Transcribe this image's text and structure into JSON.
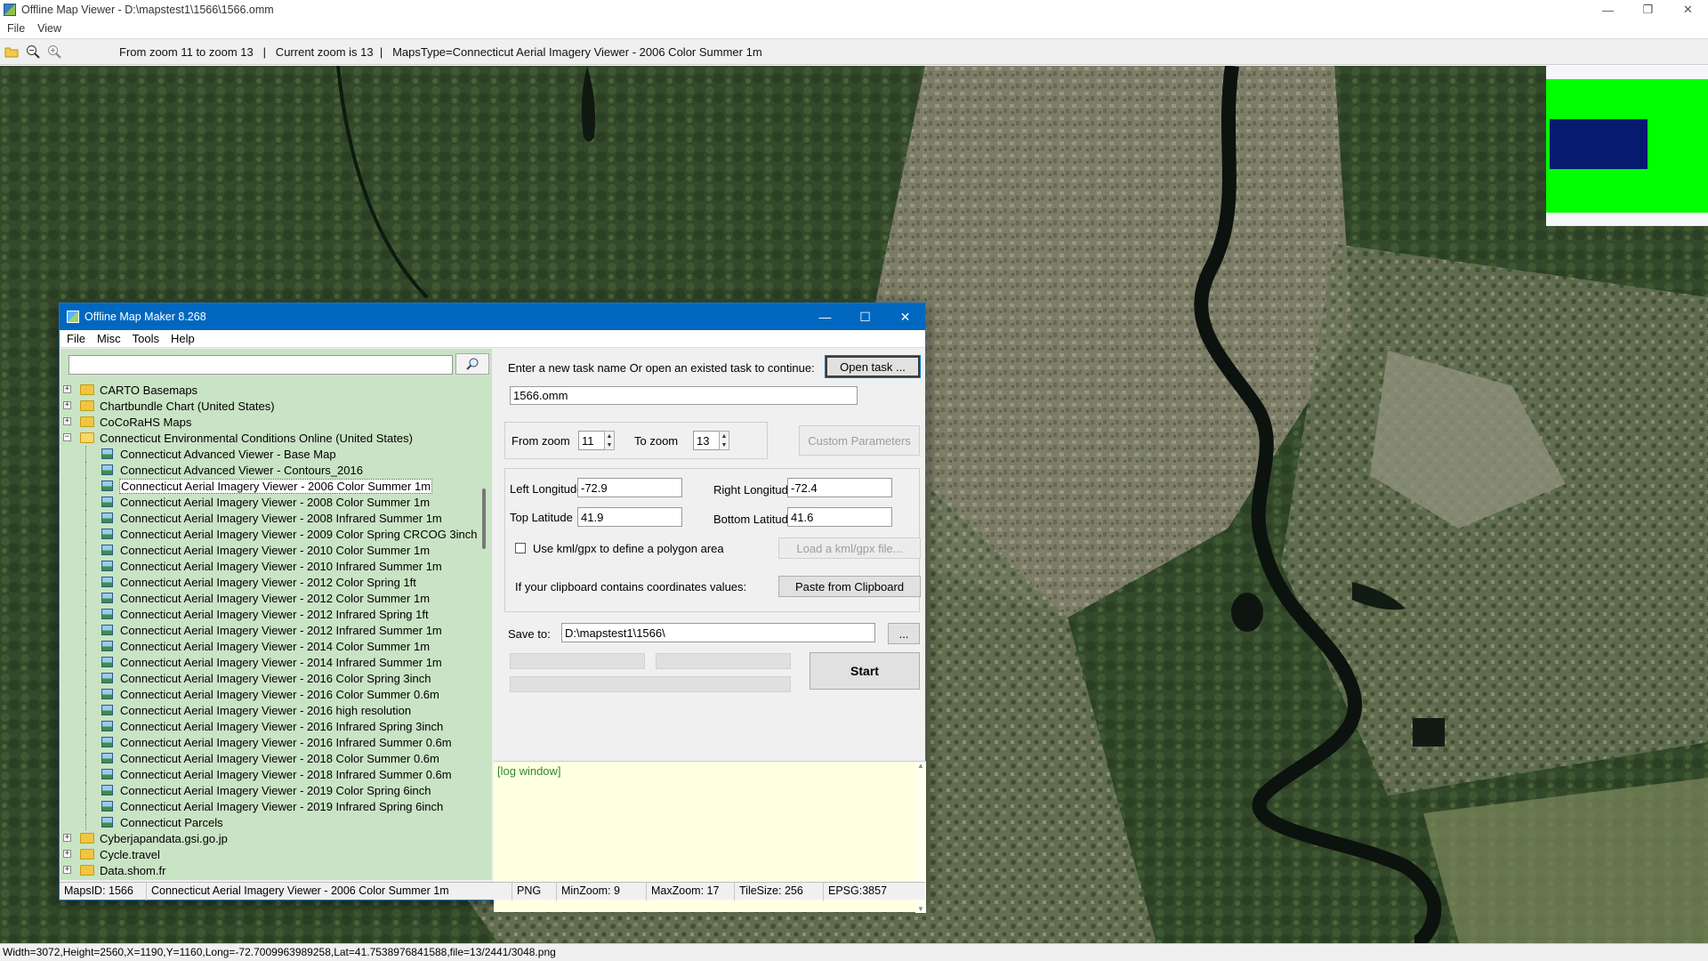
{
  "window": {
    "title": "Offline Map Viewer - D:\\mapstest1\\1566\\1566.omm",
    "minimize": "—",
    "maximize": "❐",
    "close": "✕"
  },
  "menu": {
    "file": "File",
    "view": "View"
  },
  "toolbar": {
    "icons": [
      "folder-open-icon",
      "zoom-out-icon",
      "zoom-in-icon"
    ],
    "info": "From zoom 11 to zoom 13   |   Current zoom is 13  |   MapsType=Connecticut Aerial Imagery Viewer - 2006 Color Summer 1m"
  },
  "overview": {
    "bg": "#f4f6f8",
    "green": "#00ff00",
    "box": "#061a6e"
  },
  "status_bar": "Width=3072,Height=2560,X=1190,Y=1160,Long=-72.7009963989258,Lat=41.7538976841588,file=13/2441/3048.png",
  "dialog": {
    "title": "Offline Map Maker 8.268",
    "minimize": "—",
    "maximize": "☐",
    "close": "✕",
    "menu": [
      "File",
      "Misc",
      "Tools",
      "Help"
    ],
    "search": {
      "value": "",
      "button_icon": "search-icon"
    },
    "tree": {
      "top_folders": [
        {
          "label": "CARTO Basemaps",
          "expander": "+"
        },
        {
          "label": "Chartbundle Chart (United States)",
          "expander": "+"
        },
        {
          "label": "CoCoRaHS Maps",
          "expander": "+"
        },
        {
          "label": "Connecticut Environmental Conditions Online (United States)",
          "expander": "−"
        }
      ],
      "children": [
        "Connecticut Advanced Viewer - Base Map",
        "Connecticut Advanced Viewer - Contours_2016",
        "Connecticut Aerial Imagery Viewer - 2006 Color Summer 1m",
        "Connecticut Aerial Imagery Viewer - 2008 Color Summer 1m",
        "Connecticut Aerial Imagery Viewer - 2008 Infrared Summer 1m",
        "Connecticut Aerial Imagery Viewer - 2009 Color Spring CRCOG 3inch",
        "Connecticut Aerial Imagery Viewer - 2010 Color Summer 1m",
        "Connecticut Aerial Imagery Viewer - 2010 Infrared Summer 1m",
        "Connecticut Aerial Imagery Viewer - 2012 Color Spring 1ft",
        "Connecticut Aerial Imagery Viewer - 2012 Color Summer 1m",
        "Connecticut Aerial Imagery Viewer - 2012 Infrared Spring 1ft",
        "Connecticut Aerial Imagery Viewer - 2012 Infrared Summer 1m",
        "Connecticut Aerial Imagery Viewer - 2014 Color Summer 1m",
        "Connecticut Aerial Imagery Viewer - 2014 Infrared Summer 1m",
        "Connecticut Aerial Imagery Viewer - 2016 Color Spring 3inch",
        "Connecticut Aerial Imagery Viewer - 2016 Color Summer 0.6m",
        "Connecticut Aerial Imagery Viewer - 2016 high resolution",
        "Connecticut Aerial Imagery Viewer - 2016 Infrared Spring 3inch",
        "Connecticut Aerial Imagery Viewer - 2016 Infrared Summer 0.6m",
        "Connecticut Aerial Imagery Viewer - 2018 Color Summer 0.6m",
        "Connecticut Aerial Imagery Viewer - 2018 Infrared Summer 0.6m",
        "Connecticut Aerial Imagery Viewer - 2019 Color Spring 6inch",
        "Connecticut Aerial Imagery Viewer - 2019 Infrared Spring 6inch",
        "Connecticut Parcels"
      ],
      "selected_child": "Connecticut Aerial Imagery Viewer - 2006 Color Summer 1m",
      "bottom_folders": [
        {
          "label": "Cyberjapandata.gsi.go.jp",
          "expander": "+"
        },
        {
          "label": "Cycle.travel",
          "expander": "+"
        },
        {
          "label": "Data.shom.fr",
          "expander": "+"
        }
      ]
    },
    "task": {
      "prompt": "Enter a new task name Or open an existed task to continue:",
      "open_button": "Open task ...",
      "name_value": "1566.omm"
    },
    "zoom": {
      "from_label": "From zoom",
      "from_value": "11",
      "to_label": "To zoom",
      "to_value": "13",
      "custom_button": "Custom Parameters"
    },
    "coords": {
      "left_lon_label": "Left Longitude",
      "left_lon_value": "-72.9",
      "right_lon_label": "Right Longitude",
      "right_lon_value": "-72.4",
      "top_lat_label": "Top Latitude",
      "top_lat_value": "41.9",
      "bottom_lat_label": "Bottom Latitude",
      "bottom_lat_value": "41.6",
      "kml_checkbox_label": "Use kml/gpx to define a polygon area",
      "kml_checked": false,
      "load_kml_button": "Load a kml/gpx file...",
      "clipboard_label": "If your clipboard contains coordinates values:",
      "paste_button": "Paste from Clipboard"
    },
    "save": {
      "label": "Save to:",
      "value": "D:\\mapstest1\\1566\\",
      "browse_button": "...",
      "start_button": "Start"
    },
    "log": {
      "text": "[log window]"
    },
    "status": {
      "maps_id": "MapsID: 1566",
      "map_name": "Connecticut Aerial Imagery Viewer - 2006 Color Summer 1m",
      "format": "PNG",
      "min_zoom": "MinZoom: 9",
      "max_zoom": "MaxZoom: 17",
      "tile_size": "TileSize: 256",
      "epsg": "EPSG:3857"
    }
  }
}
